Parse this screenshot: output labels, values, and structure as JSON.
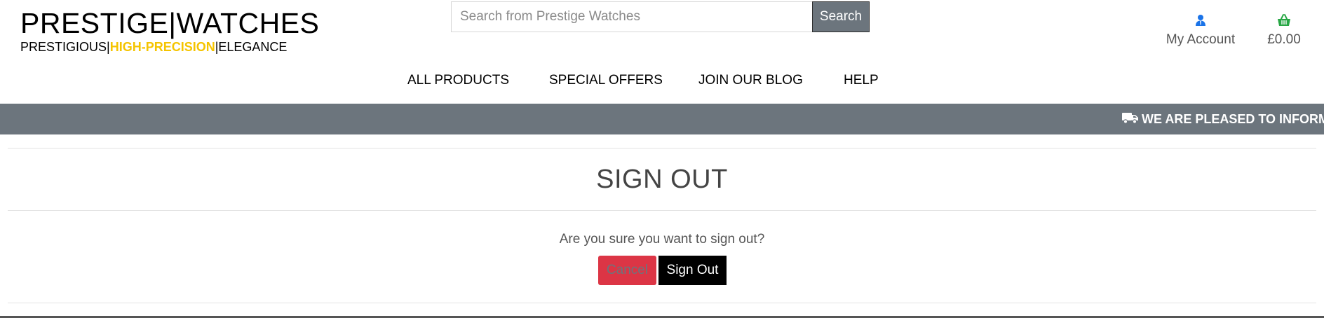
{
  "brand": {
    "title": "PRESTIGE|WATCHES",
    "tagline_part1": "PRESTIGIOUS|",
    "tagline_part2": "HIGH-PRECISION",
    "tagline_part3": "|ELEGANCE",
    "accent_color": "#f5c400"
  },
  "search": {
    "placeholder": "Search from Prestige Watches",
    "value": "",
    "button_label": "Search"
  },
  "account": {
    "icon": "user-icon",
    "label": "My Account",
    "icon_color": "#1a73e8"
  },
  "basket": {
    "icon": "basket-icon",
    "total": "£0.00",
    "icon_color": "#28a745"
  },
  "nav": {
    "items": [
      {
        "label": "ALL PRODUCTS"
      },
      {
        "label": "SPECIAL OFFERS"
      },
      {
        "label": "JOIN OUR BLOG"
      },
      {
        "label": "HELP"
      }
    ]
  },
  "banner": {
    "icon": "truck-icon",
    "text": "WE ARE PLEASED TO INFORM",
    "background": "#6c757d"
  },
  "main": {
    "title": "SIGN OUT",
    "confirm_text": "Are you sure you want to sign out?",
    "cancel_label": "Cancel",
    "signout_label": "Sign Out",
    "cancel_color": "#dc3545"
  }
}
